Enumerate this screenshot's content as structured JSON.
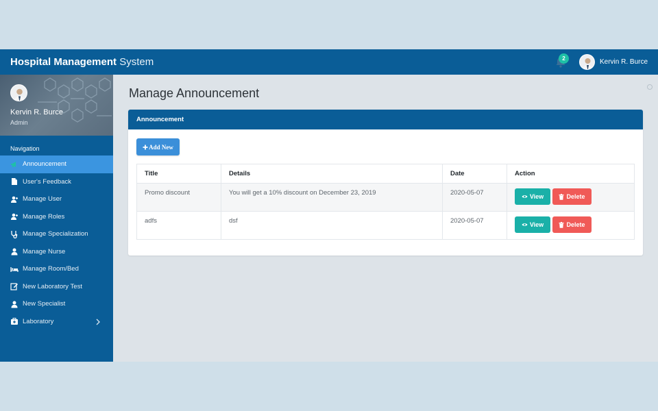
{
  "app": {
    "brand_bold": "Hospital Management",
    "brand_light": " System"
  },
  "topbar": {
    "notification_count": "2",
    "user_name": "Kervin R. Burce"
  },
  "sidebar": {
    "profile_name": "Kervin R. Burce",
    "profile_role": "Admin",
    "nav_title": "Navigation",
    "items": [
      {
        "label": "Announcement",
        "icon": "bullhorn-icon",
        "active": true
      },
      {
        "label": "User's Feedback",
        "icon": "file-icon"
      },
      {
        "label": "Manage User",
        "icon": "user-plus-icon"
      },
      {
        "label": "Manage Roles",
        "icon": "user-plus-icon"
      },
      {
        "label": "Manage Specialization",
        "icon": "stethoscope-icon"
      },
      {
        "label": "Manage Nurse",
        "icon": "user-icon"
      },
      {
        "label": "Manage Room/Bed",
        "icon": "bed-icon"
      },
      {
        "label": "New Laboratory Test",
        "icon": "edit-icon"
      },
      {
        "label": "New Specialist",
        "icon": "user-icon"
      },
      {
        "label": "Laboratory",
        "icon": "medkit-icon",
        "has_submenu": true
      }
    ]
  },
  "main": {
    "page_title": "Manage Announcement",
    "card_title": "Announcement",
    "add_button_label": "Add New",
    "table": {
      "columns": [
        "Title",
        "Details",
        "Date",
        "Action"
      ],
      "rows": [
        {
          "title": "Promo discount",
          "details": "You will get a 10% discount on December 23, 2019",
          "date": "2020-05-07"
        },
        {
          "title": "adfs",
          "details": "dsf",
          "date": "2020-05-07"
        }
      ],
      "view_label": "View",
      "delete_label": "Delete"
    }
  },
  "colors": {
    "primary": "#0a5d97",
    "active_nav": "#3b95e0",
    "view_button": "#1ab0a8",
    "delete_button": "#f05a57",
    "badge": "#1ec0a7"
  }
}
